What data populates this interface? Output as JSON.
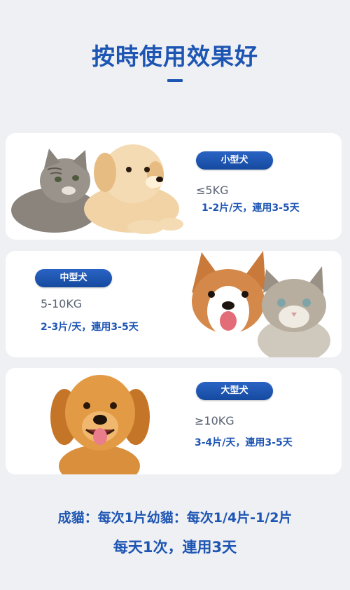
{
  "header": {
    "title": "按時使用效果好"
  },
  "cards": [
    {
      "badge": "小型犬",
      "weight": "≤5KG",
      "dose": "1-2片/天，連用3-5天",
      "image": "kitten-and-puppy-photo"
    },
    {
      "badge": "中型犬",
      "weight": "5-10KG",
      "dose": "2-3片/天，連用3-5天",
      "image": "corgi-and-cat-photo"
    },
    {
      "badge": "大型犬",
      "weight": "≥10KG",
      "dose": "3-4片/天，連用3-5天",
      "image": "golden-retriever-photo"
    }
  ],
  "footer": {
    "line1": "成貓：每次1片幼貓：每次1/4片-1/2片",
    "line2": "每天1次，連用3天"
  },
  "colors": {
    "accent": "#1d55b3",
    "background": "#eff0f3",
    "card": "#ffffff"
  }
}
